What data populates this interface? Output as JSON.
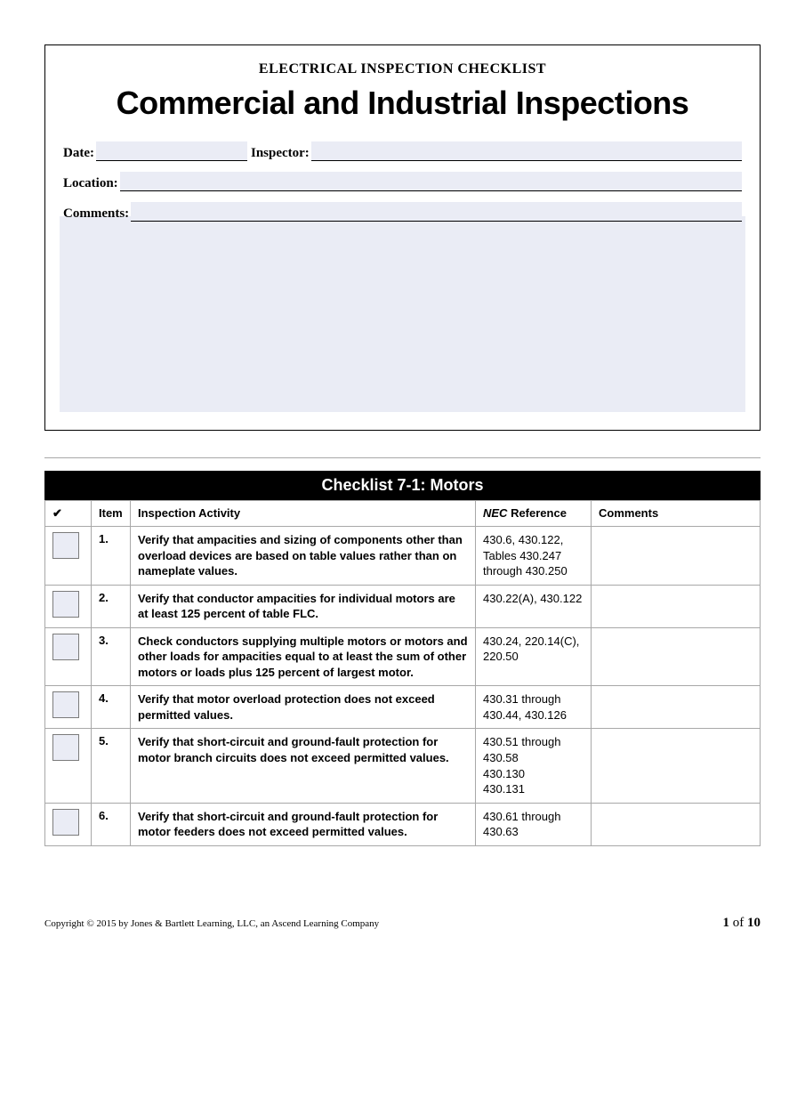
{
  "header": {
    "doc_type": "ELECTRICAL INSPECTION CHECKLIST",
    "title": "Commercial and Industrial Inspections",
    "fields": {
      "date_label": "Date:",
      "inspector_label": "Inspector:",
      "location_label": "Location:",
      "comments_label": "Comments:"
    }
  },
  "checklist": {
    "title": "Checklist 7-1: Motors",
    "columns": {
      "check": "✔",
      "item": "Item",
      "activity": "Inspection Activity",
      "ref_prefix": "NEC",
      "ref_suffix": " Reference",
      "comments": "Comments"
    },
    "rows": [
      {
        "num": "1.",
        "activity": "Verify that ampacities and sizing of components other than overload devices are based on table values rather than on nameplate values.",
        "ref": "430.6, 430.122, Tables 430.247 through 430.250",
        "comments": ""
      },
      {
        "num": "2.",
        "activity": "Verify that conductor ampacities for individual motors are at least 125 percent of table FLC.",
        "ref": "430.22(A), 430.122",
        "comments": ""
      },
      {
        "num": "3.",
        "activity": "Check conductors supplying multiple motors or motors and other loads for ampacities equal to at least the sum of other motors or loads plus 125 percent of largest motor.",
        "ref": "430.24, 220.14(C), 220.50",
        "comments": ""
      },
      {
        "num": "4.",
        "activity": "Verify that motor overload protection does not exceed permitted values.",
        "ref": "430.31 through 430.44, 430.126",
        "comments": ""
      },
      {
        "num": "5.",
        "activity": "Verify that short-circuit and ground-fault protection for motor branch circuits does not exceed permitted values.",
        "ref": "430.51 through 430.58\n430.130\n430.131",
        "comments": ""
      },
      {
        "num": "6.",
        "activity": "Verify that short-circuit and ground-fault protection for motor feeders does not exceed permitted values.",
        "ref": "430.61 through 430.63",
        "comments": ""
      }
    ]
  },
  "footer": {
    "copyright": "Copyright © 2015 by Jones & Bartlett Learning, LLC, an Ascend Learning Company",
    "page_current": "1",
    "page_of": " of ",
    "page_total": "10"
  }
}
